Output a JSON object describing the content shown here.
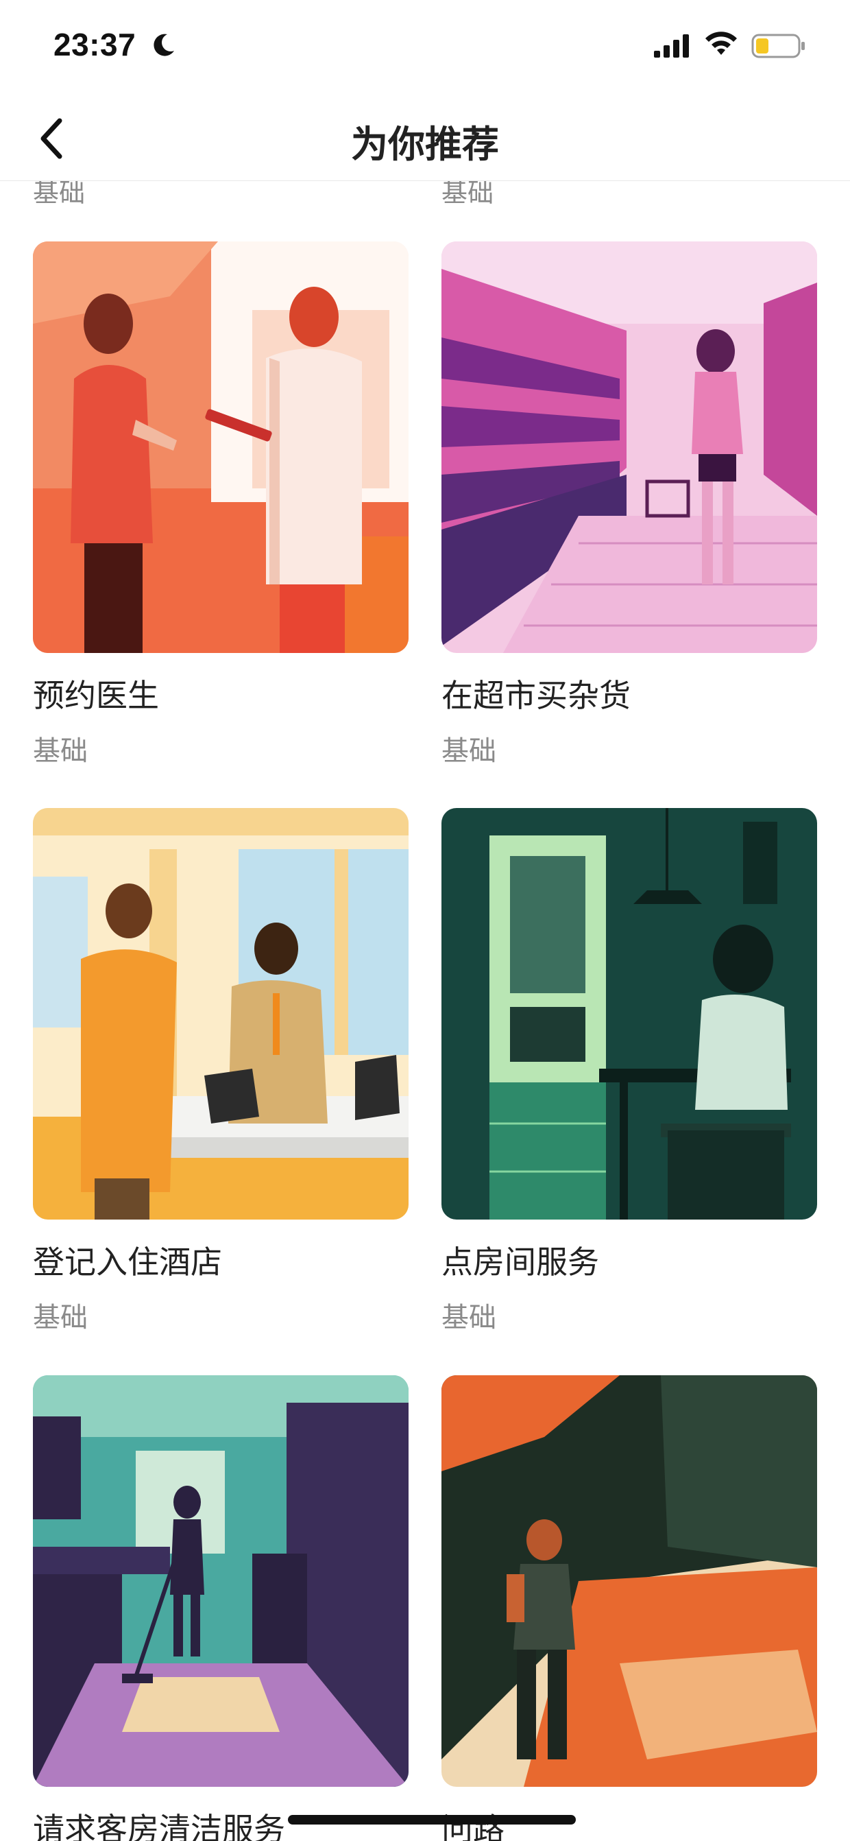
{
  "status_bar": {
    "time": "23:37"
  },
  "nav": {
    "title": "为你推荐"
  },
  "peek": {
    "left_level": "基础",
    "right_level": "基础"
  },
  "cards": [
    {
      "title": "预约医生",
      "level": "基础",
      "image": "doctor-appointment-illustration"
    },
    {
      "title": "在超市买杂货",
      "level": "基础",
      "image": "supermarket-illustration"
    },
    {
      "title": "登记入住酒店",
      "level": "基础",
      "image": "hotel-checkin-illustration"
    },
    {
      "title": "点房间服务",
      "level": "基础",
      "image": "room-service-illustration"
    },
    {
      "title": "请求客房清洁服务",
      "level": "",
      "image": "housekeeping-illustration"
    },
    {
      "title": "问路",
      "level": "",
      "image": "asking-directions-illustration"
    }
  ],
  "colors": {
    "accent_text": "#222222",
    "muted_text": "#8a8a8a"
  }
}
